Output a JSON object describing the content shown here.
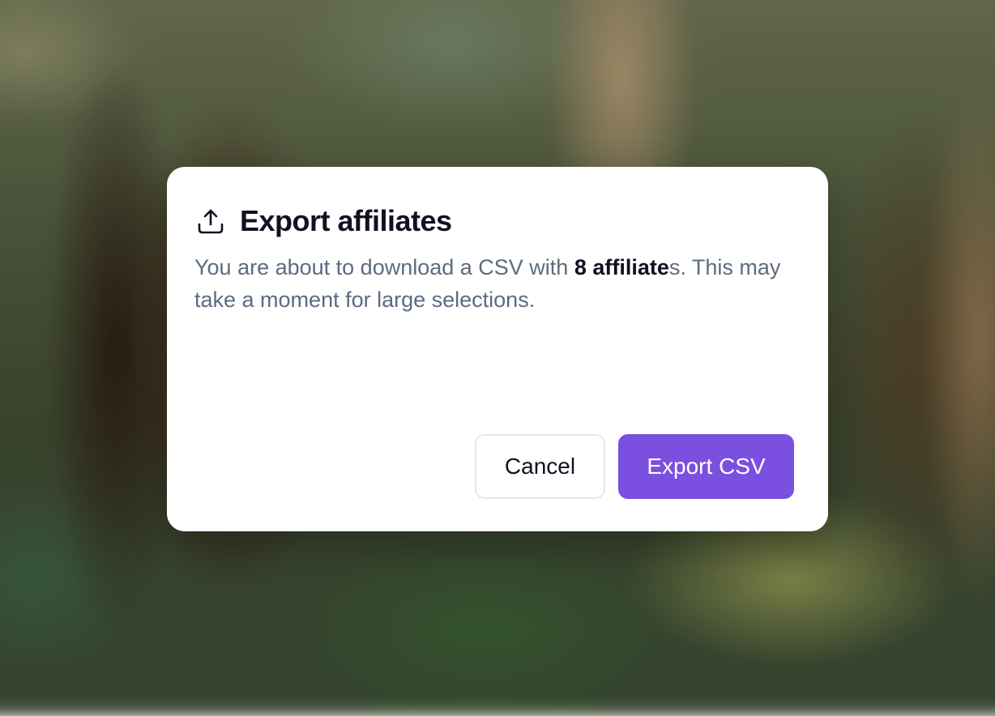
{
  "dialog": {
    "title": "Export affiliates",
    "icon": "upload-icon",
    "message_prefix": "You are about to download a CSV with ",
    "message_count": "8 affiliate",
    "message_suffix": "s. This may take a moment for large selections.",
    "cancel_label": "Cancel",
    "confirm_label": "Export CSV"
  },
  "colors": {
    "accent": "#7b4fe0",
    "title": "#0f1220",
    "body": "#5c6b7f",
    "border": "#e4e7ec"
  }
}
